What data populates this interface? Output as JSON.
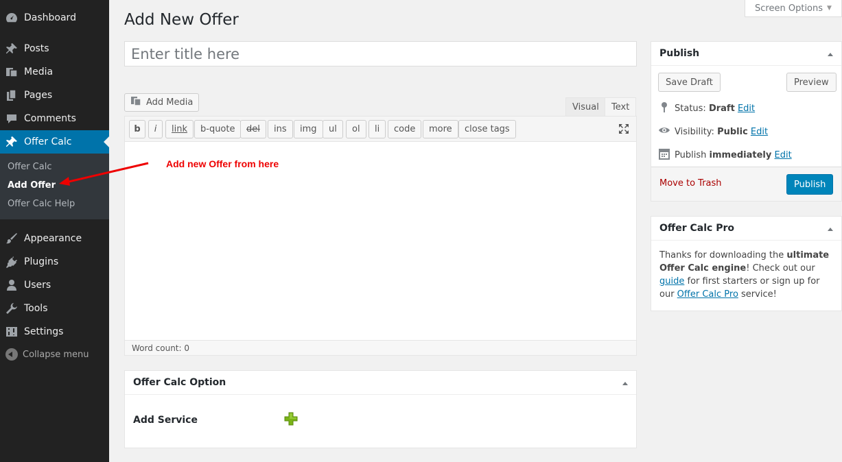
{
  "sidebar": {
    "items": [
      {
        "label": "Dashboard",
        "icon": "dashboard-icon"
      },
      {
        "label": "Posts",
        "icon": "pushpin-icon"
      },
      {
        "label": "Media",
        "icon": "media-icon"
      },
      {
        "label": "Pages",
        "icon": "pages-icon"
      },
      {
        "label": "Comments",
        "icon": "comment-icon"
      },
      {
        "label": "Offer Calc",
        "icon": "pushpin-icon"
      },
      {
        "label": "Appearance",
        "icon": "brush-icon"
      },
      {
        "label": "Plugins",
        "icon": "plug-icon"
      },
      {
        "label": "Users",
        "icon": "user-icon"
      },
      {
        "label": "Tools",
        "icon": "wrench-icon"
      },
      {
        "label": "Settings",
        "icon": "settings-icon"
      }
    ],
    "submenu": [
      "Offer Calc",
      "Add Offer",
      "Offer Calc Help"
    ],
    "collapse_label": "Collapse menu"
  },
  "screen_options": "Screen Options",
  "page_title": "Add New Offer",
  "title_placeholder": "Enter title here",
  "add_media_label": "Add Media",
  "tabs": {
    "visual": "Visual",
    "text": "Text"
  },
  "quicktags": [
    "b",
    "i",
    "link",
    "b-quote",
    "del",
    "ins",
    "img",
    "ul",
    "ol",
    "li",
    "code",
    "more",
    "close tags"
  ],
  "word_count": "Word count: 0",
  "annotation": "Add new Offer from here",
  "publish": {
    "title": "Publish",
    "save_draft": "Save Draft",
    "preview": "Preview",
    "status_label": "Status:",
    "status_value": "Draft",
    "visibility_label": "Visibility:",
    "visibility_value": "Public",
    "publish_label": "Publish",
    "publish_value": "immediately",
    "edit": "Edit",
    "trash": "Move to Trash",
    "publish_button": "Publish"
  },
  "pro": {
    "title": "Offer Calc Pro",
    "t1": "Thanks for downloading the ",
    "t2": "ultimate Offer Calc engine",
    "t3": "! Check out our ",
    "guide": "guide",
    "t4": " for first starters or sign up for our ",
    "pro_link": "Offer Calc Pro",
    "t5": " service!"
  },
  "option_box": {
    "title": "Offer Calc Option",
    "add_service": "Add Service"
  },
  "colors": {
    "accent": "#0073aa",
    "publish": "#0085ba",
    "sidebar": "#222222",
    "annotation": "#ee0000"
  }
}
